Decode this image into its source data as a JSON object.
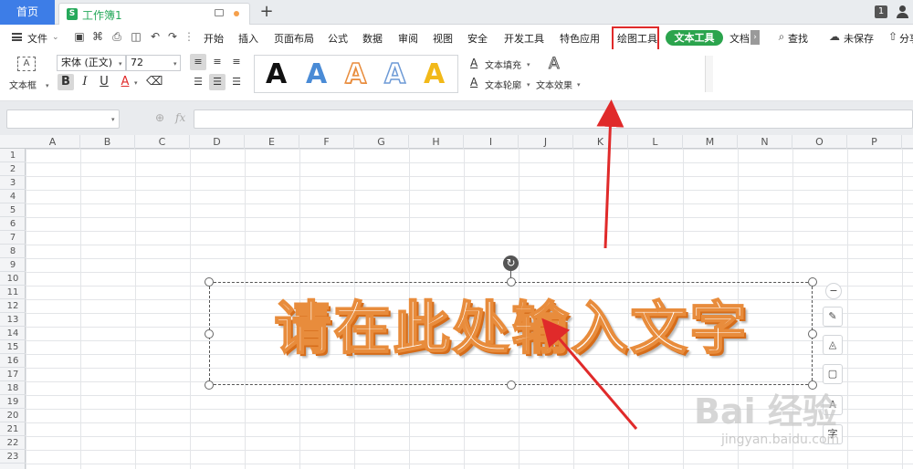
{
  "tabs": {
    "home": "首页",
    "document": "工作簿1",
    "add": "+",
    "window_badge": "1"
  },
  "menu": {
    "file": "文件",
    "items": [
      "开始",
      "插入",
      "页面布局",
      "公式",
      "数据",
      "审阅",
      "视图",
      "安全",
      "开发工具",
      "特色应用",
      "绘图工具",
      "文本工具",
      "文档"
    ],
    "search": "查找",
    "unsaved": "未保存",
    "share": "分享"
  },
  "ribbon": {
    "textbox_label": "文本框",
    "font_name": "宋体 (正文)",
    "font_size": "72",
    "bold": "B",
    "italic": "I",
    "underline": "U",
    "font_color": "A",
    "style_letter": "A",
    "text_fill": "文本填充",
    "text_outline": "文本轮廓",
    "text_effect": "文本效果"
  },
  "formula_bar": {
    "fx": "fx",
    "value": ""
  },
  "grid": {
    "columns": [
      "A",
      "B",
      "C",
      "D",
      "E",
      "F",
      "G",
      "H",
      "I",
      "J",
      "K",
      "L",
      "M",
      "N",
      "O",
      "P"
    ],
    "rows": [
      "1",
      "2",
      "3",
      "4",
      "5",
      "6",
      "7",
      "8",
      "9",
      "10",
      "11",
      "12",
      "13",
      "14",
      "15",
      "16",
      "17",
      "18",
      "19",
      "20",
      "21",
      "22",
      "23"
    ]
  },
  "textbox": {
    "content": "请在此处输入文字"
  },
  "side_tools": {
    "text_icon_1": "A",
    "text_icon_2": "字"
  },
  "watermark": {
    "main": "Bai 经验",
    "sub": "jingyan.baidu.com"
  },
  "colors": {
    "accent_blue": "#3d7de7",
    "text_tools_green": "#2ba44d",
    "highlight_red": "#e02a2a",
    "wordart_orange": "#e88c3c",
    "arrow_red": "#e02a2a"
  }
}
